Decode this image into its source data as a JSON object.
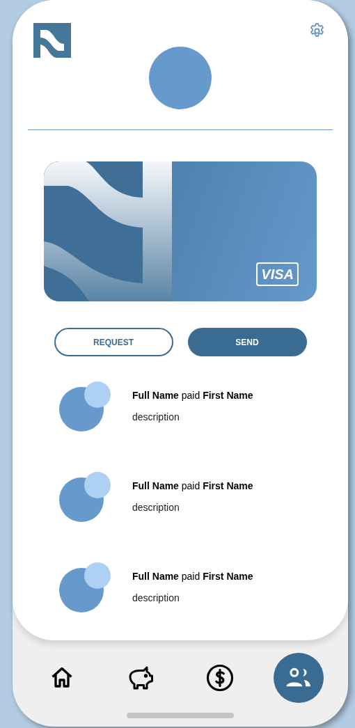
{
  "card": {
    "brand": "VISA"
  },
  "actions": [
    {
      "label": "REQUEST",
      "kind": "outline"
    },
    {
      "label": "SEND",
      "kind": "filled"
    }
  ],
  "transactions": [
    {
      "title": "**Full Name** paid **First Name**",
      "description": "description"
    },
    {
      "title": "**Full Name** paid **First Name**",
      "description": "description"
    },
    {
      "title": "**Full Name** paid **First Name**",
      "description": "description"
    }
  ],
  "nav": [
    {
      "kind": "home",
      "selected": false
    },
    {
      "kind": "savings",
      "selected": false
    },
    {
      "kind": "payments",
      "selected": false
    },
    {
      "kind": "contacts",
      "selected": true
    }
  ]
}
